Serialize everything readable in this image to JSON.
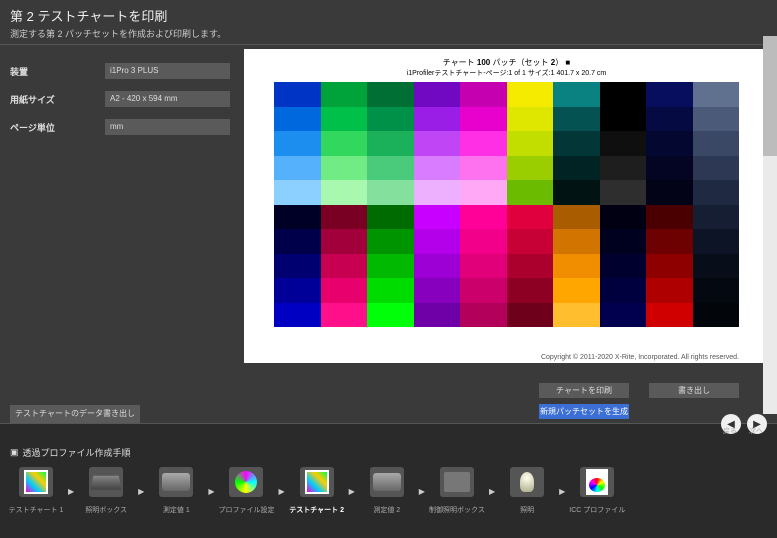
{
  "header": {
    "title": "第 2 テストチャートを印刷",
    "subtitle": "測定する第 2 パッチセットを作成および印刷します。"
  },
  "fields": {
    "device_label": "装置",
    "device_value": "i1Pro 3 PLUS",
    "paper_label": "用紙サイズ",
    "paper_value": "A2 - 420 x 594 mm",
    "unit_label": "ページ単位",
    "unit_value": "mm"
  },
  "export_btn": "テストチャートのデータ書き出し",
  "chart": {
    "title_prefix": "チャート ",
    "title_count": "100",
    "title_suffix": " パッチ（セット",
    "title_set": "2",
    "title_end": "）",
    "subtitle": "i1Profilerテストチャート-ページ:1 of 1 サイズ:1 401.7 x 20.7 cm",
    "copyright": "Copyright © 2011-2020 X-Rite, Incorporated. All rights reserved."
  },
  "actions": {
    "print": "チャートを印刷",
    "export": "書き出し",
    "gen_patch": "新規パッチセットを生成"
  },
  "nav": {
    "back": "戻る",
    "next": "次へ"
  },
  "workflow_title": "透過プロファイル作成手順",
  "steps": [
    {
      "label": "テストチャート 1",
      "icon": "ic-chart"
    },
    {
      "label": "照明ボックス",
      "icon": "ic-box"
    },
    {
      "label": "測定値 1",
      "icon": "ic-device"
    },
    {
      "label": "プロファイル設定",
      "icon": "ic-gear"
    },
    {
      "label": "テストチャート 2",
      "icon": "ic-chart",
      "active": true
    },
    {
      "label": "測定値 2",
      "icon": "ic-device"
    },
    {
      "label": "制御照明ボックス",
      "icon": "ic-folder"
    },
    {
      "label": "照明",
      "icon": "ic-bulb"
    },
    {
      "label": "ICC プロファイル",
      "icon": "ic-profile"
    }
  ],
  "chart_data": {
    "type": "heatmap",
    "title": "Color Test Chart 100 patches (Set 2)",
    "rows": 10,
    "cols": 10,
    "colors": [
      [
        "#0034c4",
        "#00a33a",
        "#006f34",
        "#7109c2",
        "#c400b0",
        "#f5eb00",
        "#0a8282",
        "#000000",
        "#070e5e",
        "#5f718f"
      ],
      [
        "#0068de",
        "#00c04a",
        "#009149",
        "#9b1ee6",
        "#e800cd",
        "#dfe700",
        "#055252",
        "#000000",
        "#050a42",
        "#4a5a78"
      ],
      [
        "#1b8ef0",
        "#31d85d",
        "#1bb05a",
        "#c046f5",
        "#ff2fe5",
        "#c2de00",
        "#033737",
        "#0f0f0f",
        "#040730",
        "#3a4866"
      ],
      [
        "#55b1fc",
        "#71ec84",
        "#4acb7b",
        "#da7cff",
        "#ff72ef",
        "#9bce00",
        "#022323",
        "#1e1e1e",
        "#030522",
        "#2c3854"
      ],
      [
        "#8bd0ff",
        "#a9f8af",
        "#83e19d",
        "#edafff",
        "#ffa9f6",
        "#6bbc00",
        "#011313",
        "#2e2e2e",
        "#020316",
        "#1f2942"
      ],
      [
        "#000027",
        "#7a0023",
        "#006b00",
        "#c800ff",
        "#ff0098",
        "#e0003e",
        "#aa5c00",
        "#000012",
        "#4a0000",
        "#151e33"
      ],
      [
        "#00004a",
        "#a1003a",
        "#009400",
        "#b400ea",
        "#f3008a",
        "#c70036",
        "#d17500",
        "#00001f",
        "#6d0000",
        "#0d1425"
      ],
      [
        "#000070",
        "#c70052",
        "#00b900",
        "#9d00d4",
        "#e2007a",
        "#ab002d",
        "#f08e00",
        "#00002e",
        "#8e0000",
        "#080d1a"
      ],
      [
        "#000099",
        "#e8006d",
        "#00db00",
        "#8600be",
        "#cc006a",
        "#8d0024",
        "#ffa600",
        "#00003e",
        "#af0000",
        "#040810"
      ],
      [
        "#0000c2",
        "#ff0f8a",
        "#00ff08",
        "#6f00a8",
        "#b3005a",
        "#6e001b",
        "#ffbe2d",
        "#00004e",
        "#d00000",
        "#02050a"
      ]
    ]
  }
}
